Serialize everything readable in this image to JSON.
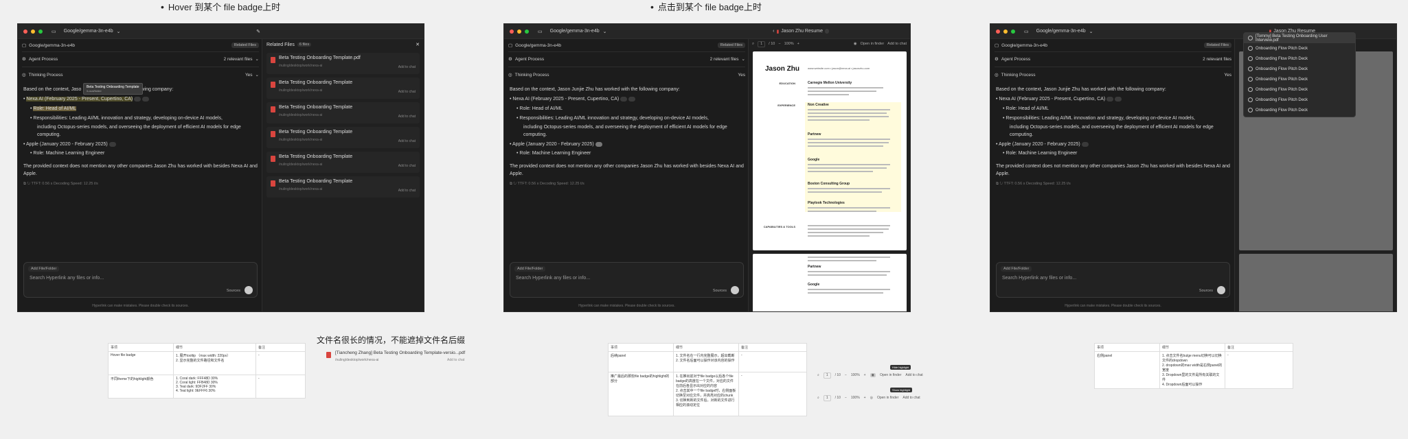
{
  "titles": {
    "hover": "Hover 到某个 file badge上时",
    "click": "点击到某个 file badge上时",
    "long_name": "文件名很长的情况，不能遮掉文件名后缀"
  },
  "window": {
    "model": "Google/gemma-3n-e4b",
    "related_files_btn": "Related Files",
    "agent_process": "Agent Process",
    "relevant_files": "2 relevant files",
    "thinking_process": "Thinking Process",
    "tokens": "Yes"
  },
  "chat": {
    "intro": "Based on the context, Jason Junjie Zhu has worked with the following company:",
    "intro_hover_a": "Based on the context, Jaso",
    "intro_hover_b": "llowing company:",
    "item1": "Nexa AI (February 2025 - Present, Cupertino, CA)",
    "role1": "Role: Head of AI/ML",
    "resp1": "Responsibilities: Leading AI/ML innovation and strategy, developing on-device AI models,",
    "resp1b": "including Octopus-series models, and overseeing the deployment of efficient AI models for edge computing.",
    "item2": "Apple (January 2020 - February 2025)",
    "role2": "Role: Machine Learning Engineer",
    "note": "The provided context does not mention any other companies Jason Zhu has worked with besides Nexa AI and Apple.",
    "meta": "TTFT: 0.56 s    Decoding Speed: 12.25 t/s",
    "add_file": "Add File/Folder",
    "placeholder": "Search Hyperlink any files or info...",
    "sources": "Sources",
    "footer": "Hyperlink can make mistakes. Please double check its sources."
  },
  "tooltip": {
    "name": "Beta Testing Onboarding Template",
    "path": "/Local/folder"
  },
  "related": {
    "header": "Related Files",
    "count": "6 files",
    "files": [
      {
        "name": "Beta Testing Onboarding Template.pdf",
        "path": "/nuling/desktop/work/nexa-ai",
        "add": "Add to chat"
      },
      {
        "name": "Beta Testing Onboarding Template",
        "path": "/nuling/desktop/work/nexa-ai",
        "add": "Add to chat"
      },
      {
        "name": "Beta Testing Onboarding Template",
        "path": "/nuling/desktop/work/nexa-ai",
        "add": "Add to chat"
      },
      {
        "name": "Beta Testing Onboarding Template",
        "path": "/nuling/desktop/work/nexa-ai",
        "add": "Add to chat"
      },
      {
        "name": "Beta Testing Onboarding Template",
        "path": "/nuling/desktop/work/nexa-ai",
        "add": "Add to chat"
      },
      {
        "name": "Beta Testing Onboarding Template",
        "path": "/nuling/desktop/work/nexa-ai",
        "add": "Add to chat"
      }
    ]
  },
  "pdf": {
    "tab": "Jason Zhu Resume",
    "page": "1",
    "pages": "/ 10",
    "zoom": "100%",
    "open_in_finder": "Open in finder",
    "add_to_chat": "Add to chat",
    "name": "Jason Zhu",
    "contact": "www.website.com  •  jason@nexa.ai  •  jasonzhu.com",
    "sections": [
      "EDUCATION",
      "EXPERIENCE",
      "CAPABILITIES & TOOLS"
    ],
    "edu": "Carnegie Mellon University",
    "jobs": [
      "Non Creative",
      "Partnew",
      "Google",
      "Boston Consulting Group",
      "Playlook Technologies"
    ],
    "jobs_p2": [
      "Partnew",
      "Google"
    ]
  },
  "dropdown": {
    "items": [
      "[Tommy] Beta Testing Onboarding User Interview.pdf",
      "Onboarding Flow Pitch Deck",
      "Onboarding Flow Pitch Deck",
      "Onboarding Flow Pitch Deck",
      "Onboarding Flow Pitch Deck",
      "Onboarding Flow Pitch Deck",
      "Onboarding Flow Pitch Deck",
      "Onboarding Flow Pitch Deck"
    ]
  },
  "long_file": {
    "name": "[Tiancheng Zhang] Beta Testing Onboarding Template-versio...pdf",
    "path": "/nuling/desktop/work/nexa-ai",
    "add": "Add to chat"
  },
  "tables": {
    "t1": {
      "h": [
        "事项",
        "细节",
        "备注"
      ],
      "rows": [
        [
          "Hover file badge",
          "1. 展开tooltip （max width: 220px）\n2. 显示完整的文件路径和文件名",
          "-"
        ],
        [
          "不同theme下的highlight颜色",
          "1. Coral dark: FFF48D 30%\n2. Coral light: FFB48D 30%\n3. Teal dark: 9DF2FF 30%\n4. Teal light: 9EFFF6 30%",
          "-"
        ]
      ]
    },
    "t2": {
      "h": [
        "事项",
        "细节",
        "备注"
      ],
      "rows": [
        [
          "后续panel",
          "1. 文件名在一行内完整展示，超出截断\n2. 文件名后面可以操作对该内容的操作",
          "-"
        ],
        [
          "推广最后的那些file badge的highlight的部分",
          "1. 在推出前对于file badge以后各个file badge的高度在一个文件，对应的文件在前后各显示出对应的内容\n2. 点击其中一个file badge时，右侧面板切换至对应文件，并高亮对应的chunk\n3. 切换到新的文件后，对新的文件进行相应的滚动定位",
          "-"
        ]
      ]
    },
    "t3": {
      "h": [
        "事项",
        "细节",
        "备注"
      ],
      "rows": [
        [
          "右侧panel",
          "1. 点击文件名bulge menu切换可以切换文件的dropdown\n2. dropdown的max width是右侧panel的宽度\n3. Dropdown里的文件是所有关联的文件\n4. Dropdown后面可以操作",
          "-"
        ]
      ]
    }
  },
  "toolbar_variants": [
    {
      "tip": "Hide highlight",
      "page": "1",
      "pages": "/ 10",
      "zoom": "100%",
      "open": "Open in finder",
      "add": "Add to chat"
    },
    {
      "tip": "Show highlight",
      "page": "1",
      "pages": "/ 10",
      "zoom": "100%",
      "open": "Open in finder",
      "add": "Add to chat"
    }
  ]
}
